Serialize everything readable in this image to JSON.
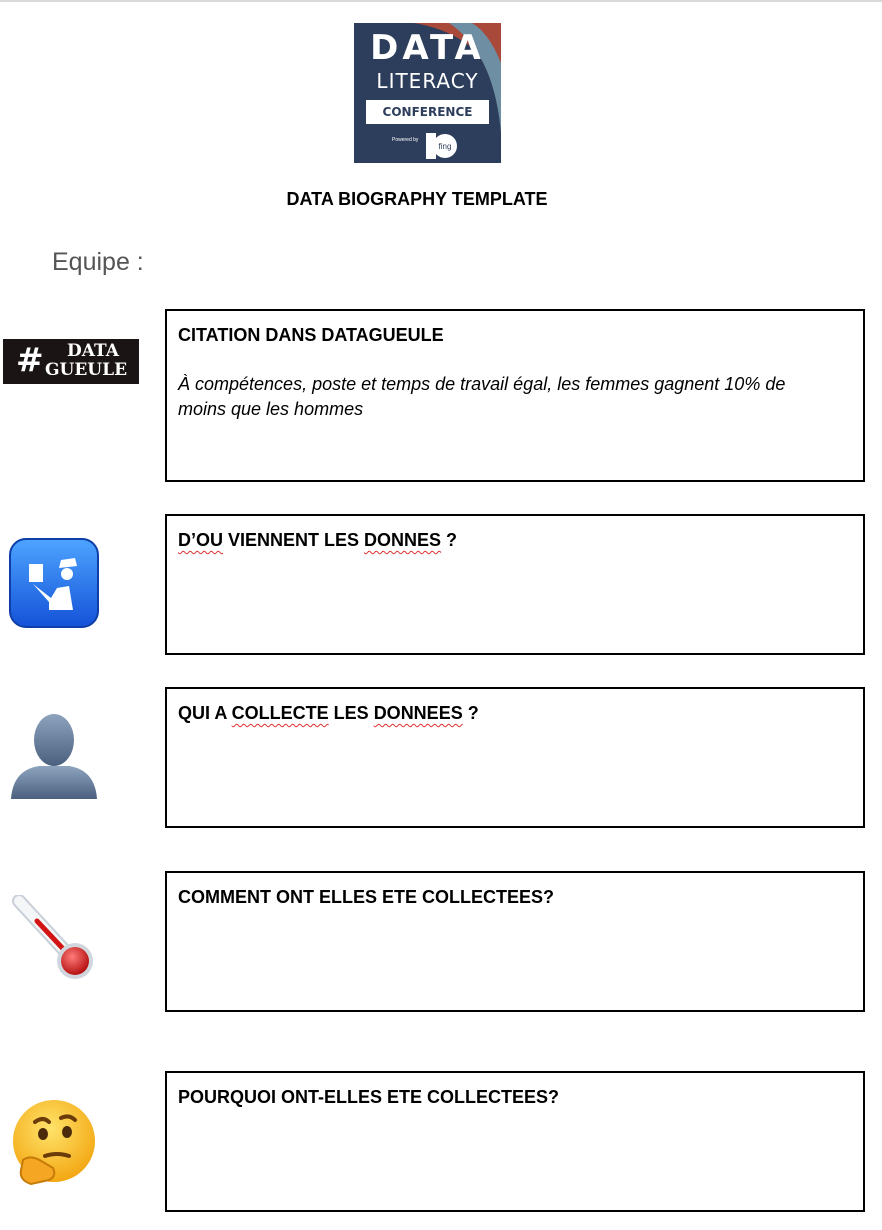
{
  "logo": {
    "line1": "DATA",
    "line2": "LITERACY",
    "line3": "CONFERENCE",
    "powered_by": "Powered by",
    "partner": "fing"
  },
  "document": {
    "title": "DATA BIOGRAPHY TEMPLATE",
    "team_label": "Equipe :"
  },
  "datagueule_logo": {
    "hash": "#",
    "word1": "DATA",
    "word2": "GUEULE"
  },
  "sections": {
    "citation": {
      "heading": "CITATION DANS DATAGUEULE",
      "quote": "À compétences, poste et temps de travail égal, les femmes gagnent 10% de moins que les hommes"
    },
    "origin": {
      "heading_a": "D’OU",
      "heading_b": " VIENNENT LES ",
      "heading_c": "DONNES",
      "heading_d": " ?"
    },
    "collector": {
      "heading_a": "QUI A ",
      "heading_b": "COLLECTE",
      "heading_c": " LES ",
      "heading_d": "DONNEES",
      "heading_e": " ?"
    },
    "method": {
      "heading": "COMMENT ONT ELLES ETE COLLECTEES?"
    },
    "purpose": {
      "heading": "POURQUOI ONT-ELLES ETE COLLECTEES?"
    }
  },
  "icons": {
    "origin": "passport-control-icon",
    "collector": "person-silhouette-icon",
    "method": "thermometer-icon",
    "purpose": "thinking-face-icon"
  }
}
